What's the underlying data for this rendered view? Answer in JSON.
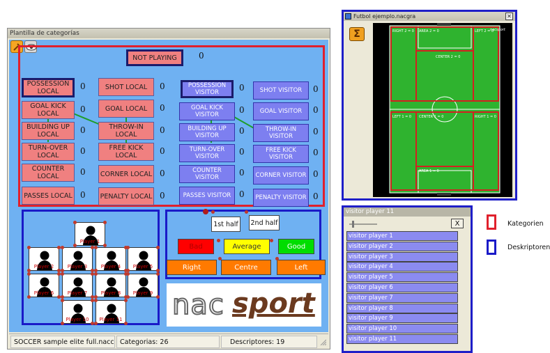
{
  "main_window": {
    "title": "Plantilla de categorías",
    "not_playing": {
      "label": "NOT PLAYING",
      "count": "0"
    },
    "local_categories": [
      {
        "label": "POSSESSION LOCAL",
        "count": "0"
      },
      {
        "label": "GOAL KICK LOCAL",
        "count": "0"
      },
      {
        "label": "BUILDING UP LOCAL",
        "count": "0"
      },
      {
        "label": "TURN-OVER LOCAL",
        "count": "0"
      },
      {
        "label": "COUNTER LOCAL",
        "count": "0"
      },
      {
        "label": "PASSES LOCAL",
        "count": "0"
      }
    ],
    "local_categories_2": [
      {
        "label": "SHOT LOCAL",
        "count": "0"
      },
      {
        "label": "GOAL LOCAL",
        "count": "0"
      },
      {
        "label": "THROW-IN LOCAL",
        "count": "0"
      },
      {
        "label": "FREE KICK LOCAL",
        "count": "0"
      },
      {
        "label": "CORNER LOCAL",
        "count": "0"
      },
      {
        "label": "PENALTY LOCAL",
        "count": "0"
      }
    ],
    "visitor_categories": [
      {
        "label": "POSSESSION VISITOR",
        "count": "0"
      },
      {
        "label": "GOAL KICK VISITOR",
        "count": "0"
      },
      {
        "label": "BUILDING UP VISITOR",
        "count": "0"
      },
      {
        "label": "TURN-OVER VISITOR",
        "count": "0"
      },
      {
        "label": "COUNTER VISITOR",
        "count": "0"
      },
      {
        "label": "PASSES VISITOR",
        "count": "0"
      }
    ],
    "visitor_categories_2": [
      {
        "label": "SHOT VISITOR",
        "count": "0"
      },
      {
        "label": "GOAL VISITOR",
        "count": "0"
      },
      {
        "label": "THROW-IN VISITOR",
        "count": "0"
      },
      {
        "label": "FREE KICK VISITOR",
        "count": "0"
      },
      {
        "label": "CORNER VISITOR",
        "count": "0"
      },
      {
        "label": "PENALTY VISITOR",
        "count": "0"
      }
    ],
    "players": [
      "Player 1",
      "Player 2",
      "Player 3",
      "Player 4",
      "Player 5",
      "Player 6",
      "Player 7",
      "Player 8",
      "Player 9",
      "Player 10",
      "Player 11"
    ],
    "halves": [
      "1st half",
      "2nd half"
    ],
    "evaluations": [
      {
        "label": "Bad",
        "color": "#ff0000",
        "text_color": "#b00000"
      },
      {
        "label": "Average",
        "color": "#ffff00",
        "text_color": "#333333"
      },
      {
        "label": "Good",
        "color": "#00dd00",
        "text_color": "#ffffff"
      }
    ],
    "sides": [
      "Right",
      "Centre",
      "Left"
    ],
    "side_color": "#ff7a00",
    "logo": {
      "prefix": "nac",
      "suffix": "sport"
    },
    "status": {
      "file": "SOCCER sample elite full.nacc",
      "categories": "Categorias: 26",
      "descriptors": "Descriptores: 19"
    }
  },
  "field_window": {
    "title": "Futbol ejemplo.nacgra",
    "sigma": "Σ",
    "logo": "nacsport",
    "zones": [
      {
        "label": "RIGHT 2 = 0"
      },
      {
        "label": "AREA 2 = 0"
      },
      {
        "label": "LEFT 2 = 0"
      },
      {
        "label": "CENTER 2 = 0"
      },
      {
        "label": "LEFT 1 = 0"
      },
      {
        "label": "CENTER 1 = 0"
      },
      {
        "label": "RIGHT 1 = 0"
      },
      {
        "label": "AREA 1 = 0"
      }
    ]
  },
  "list_window": {
    "title": "visitor player 11",
    "close_label": "X",
    "items": [
      "visitor player 1",
      "visitor player 2",
      "visitor player 3",
      "visitor player 4",
      "visitor player 5",
      "visitor player 6",
      "visitor player 7",
      "visitor player 8",
      "visitor player 9",
      "visitor player 10",
      "visitor player 11"
    ]
  },
  "legend": {
    "kategorien": {
      "label": "Kategorien",
      "color": "#e0202c"
    },
    "deskriptoren": {
      "label": "Deskriptoren",
      "color": "#1a1ac8"
    }
  },
  "colors": {
    "canvas": "#6fb1f2",
    "category": "#f08080",
    "descriptor": "#7d7ff0",
    "pitch": "#2fb32f"
  }
}
